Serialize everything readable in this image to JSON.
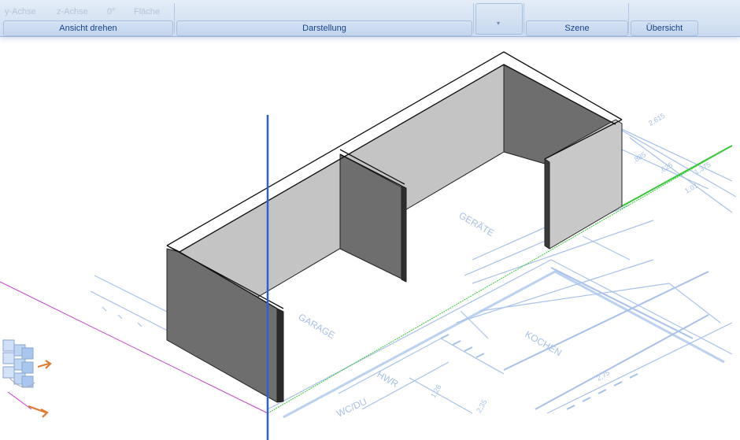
{
  "ribbon": {
    "top_labels": [
      "y-Achse",
      "z-Achse",
      "0°",
      "Fläche"
    ],
    "groups": [
      {
        "label": "Ansicht drehen"
      },
      {
        "label": "Darstellung"
      },
      {
        "label": "Szene"
      },
      {
        "label": "Übersicht"
      }
    ],
    "dropdown_arrow": "▾"
  },
  "viewport": {
    "rooms": [
      "GARAGE",
      "GERÄTE",
      "KOCHEN",
      "HWR",
      "WC/DU"
    ],
    "dimensions": [
      "2,615",
      "1,375",
      "1,01",
      "2,75",
      "1,26",
      "2,35",
      ",885",
      ",625"
    ],
    "axis_colors": {
      "z": "#2f5fd0",
      "y": "#37c837",
      "x": "#c83cc8"
    },
    "wall_colors": {
      "light": "#c4c4c4",
      "dark": "#6e6e6e",
      "top": "#ffffff"
    }
  },
  "navigation_cube": {
    "icon": "navigation-cube-icon"
  }
}
